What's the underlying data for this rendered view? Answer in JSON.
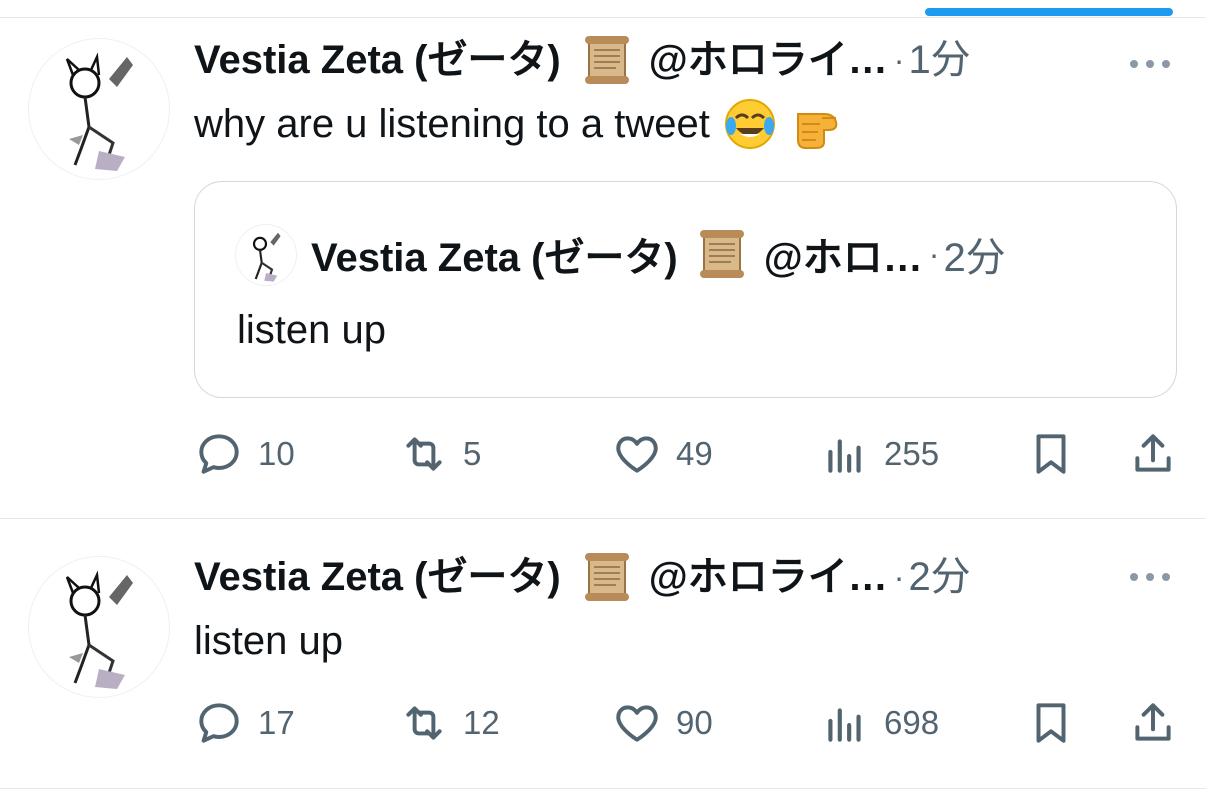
{
  "theme": {
    "accent": "#1d9bf0",
    "text": "#0f1419",
    "muted": "#536471",
    "border": "#cfd9de"
  },
  "tweets": [
    {
      "author": {
        "display_name": "Vestia Zeta (ゼータ)",
        "badge_icon": "scroll-emoji-icon",
        "handle": "@ホロライ…"
      },
      "time": "1分",
      "text": "why are u listening to a tweet",
      "emojis": [
        "face-with-tears-of-joy-emoji",
        "pointing-fist-emoji"
      ],
      "quote": {
        "author": {
          "display_name": "Vestia Zeta (ゼータ)",
          "badge_icon": "scroll-emoji-icon",
          "handle": "@ホロ…"
        },
        "time": "2分",
        "text": "listen up"
      },
      "stats": {
        "replies": "10",
        "retweets": "5",
        "likes": "49",
        "views": "255"
      }
    },
    {
      "author": {
        "display_name": "Vestia Zeta (ゼータ)",
        "badge_icon": "scroll-emoji-icon",
        "handle": "@ホロライ…"
      },
      "time": "2分",
      "text": "listen up",
      "stats": {
        "replies": "17",
        "retweets": "12",
        "likes": "90",
        "views": "698"
      }
    }
  ]
}
